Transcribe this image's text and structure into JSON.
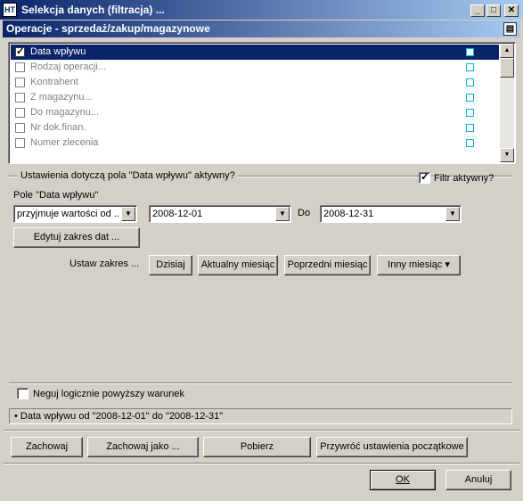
{
  "window": {
    "title": "Selekcja danych (filtracja) ...",
    "icon_text": "HT",
    "minimize_glyph": "_",
    "maximize_glyph": "□",
    "close_glyph": "✕"
  },
  "subtitle": "Operacje - sprzedaż/zakup/magazynowe",
  "fields": [
    {
      "label": "Data wpływu",
      "checked": true,
      "selected": true
    },
    {
      "label": "Rodzaj operacji...",
      "checked": false,
      "selected": false
    },
    {
      "label": "Kontrahent",
      "checked": false,
      "selected": false
    },
    {
      "label": "Z magazynu...",
      "checked": false,
      "selected": false
    },
    {
      "label": "Do magazynu...",
      "checked": false,
      "selected": false
    },
    {
      "label": "Nr dok.finan.",
      "checked": false,
      "selected": false
    },
    {
      "label": "Numer zlecenia",
      "checked": false,
      "selected": false
    }
  ],
  "scroll": {
    "up": "▲",
    "down": "▼"
  },
  "settings": {
    "group_title": "Ustawienia dotyczą pola \"Data wpływu\" aktywny?",
    "filter_active_label": "Filtr aktywny?",
    "filter_active": true,
    "field_label": "Pole \"Data wpływu\"",
    "mode_value": "przyjmuje wartości od ..",
    "from_date": "2008-12-01",
    "to_label": "Do",
    "to_date": "2008-12-31",
    "edit_range_button": "Edytuj zakres dat ...",
    "set_range_label": "Ustaw zakres ...",
    "today_button": "Dzisiaj",
    "current_month_button": "Aktualny miesiąc",
    "previous_month_button": "Poprzedni miesiąc",
    "other_month_button": "Inny miesiąc ▾",
    "dropdown_arrow": "▼"
  },
  "negate_label": "Neguj logicznie powyższy warunek",
  "status_text": "• Data wpływu od \"2008-12-01\" do \"2008-12-31\"",
  "actions": {
    "save": "Zachowaj",
    "save_as": "Zachowaj jako ...",
    "load": "Pobierz",
    "restore": "Przywróć ustawienia początkowe"
  },
  "dialog": {
    "ok": "OK",
    "cancel": "Anuluj"
  },
  "colors": {
    "selection": "#0a246a",
    "marker": "#00b5d8",
    "face": "#d4d0c8"
  }
}
